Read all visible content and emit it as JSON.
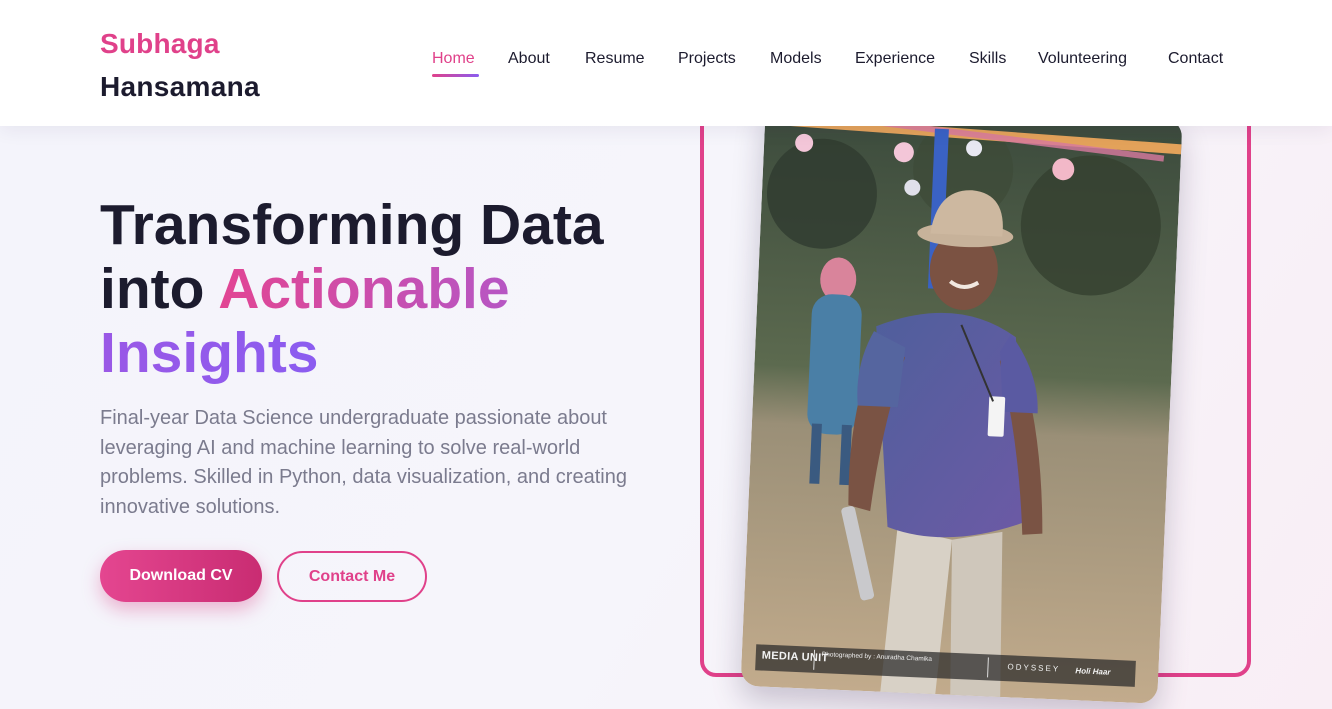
{
  "header": {
    "brand_first": "Subhaga",
    "brand_last": "Hansamana",
    "nav": [
      {
        "label": "Home",
        "active": true
      },
      {
        "label": "About",
        "active": false
      },
      {
        "label": "Resume",
        "active": false
      },
      {
        "label": "Projects",
        "active": false
      },
      {
        "label": "Models",
        "active": false
      },
      {
        "label": "Experience",
        "active": false
      },
      {
        "label": "Skills",
        "active": false
      },
      {
        "label": "Volunteering",
        "active": false
      },
      {
        "label": "Contact",
        "active": false
      }
    ]
  },
  "hero": {
    "title_line1": "Transforming Data",
    "title_line2_prefix": "into ",
    "title_line2_highlight": "Actionable",
    "title_line3": "Insights",
    "description": "Final-year Data Science undergraduate passionate about leveraging AI and machine learning to solve real-world problems. Skilled in Python, data visualization, and creating innovative solutions.",
    "primary_button": "Download CV",
    "secondary_button": "Contact Me"
  },
  "photo": {
    "credit_logo": "MEDIA UNIT",
    "credit_text": "Photographed by : Anuradha Chamika",
    "credit_brand1": "ODYSSEY",
    "credit_brand2": "Holi Haar"
  },
  "colors": {
    "accent_pink": "#e0418a",
    "accent_purple": "#8b5cf0",
    "text_dark": "#1c1b2e",
    "text_muted": "#7b7b8e"
  }
}
